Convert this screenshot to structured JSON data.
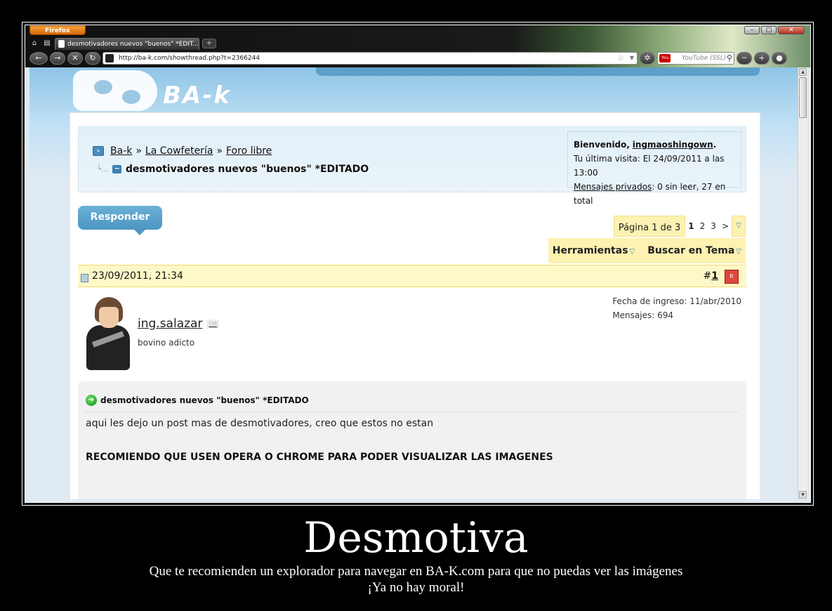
{
  "browser": {
    "menu_button": "Firefox",
    "tab_title": "desmotivadores nuevos \"buenos\" *EDIT...",
    "url": "http://ba-k.com/showthread.php?t=2366244",
    "search_placeholder": "YouTube (SSL)",
    "icons": [
      "home-icon",
      "back-icon",
      "forward-icon",
      "stop-icon",
      "reload-icon",
      "star-icon",
      "search-icon"
    ]
  },
  "site": {
    "logo_text": "BA-k"
  },
  "breadcrumb": {
    "items": [
      "Ba-k",
      "La Cowfetería",
      "Foro libre"
    ],
    "separator": "»",
    "current_thread": "desmotivadores nuevos \"buenos\" *EDITADO"
  },
  "welcome": {
    "greeting": "Bienvenido,",
    "username": "ingmaoshingown",
    "last_visit": "Tu última visita: El 24/09/2011 a las 13:00",
    "pm_link": "Mensajes privados",
    "pm_status": ": 0 sin leer, 27 en total"
  },
  "reply_button": "Responder",
  "pagination": {
    "label": "Página 1 de 3",
    "pages": [
      "1",
      "2",
      "3"
    ],
    "current": "1",
    "next": ">"
  },
  "tools": {
    "tools_label": "Herramientas",
    "search_label": "Buscar en Tema"
  },
  "post": {
    "date": "23/09/2011, 21:34",
    "number_prefix": "#",
    "number": "1",
    "username": "ing.salazar",
    "status": "Off",
    "user_title": "bovino adicto",
    "join_date": "Fecha de ingreso: 11/abr/2010",
    "messages": "Mensajes: 694",
    "title": "desmotivadores nuevos \"buenos\" *EDITADO",
    "text1": "aqui les dejo un post mas de desmotivadores, creo que estos no estan",
    "text2": "RECOMIENDO QUE USEN OPERA O CHROME PARA PODER VISUALIZAR LAS IMAGENES"
  },
  "caption": {
    "title": "Desmotiva",
    "line1": "Que te recomienden un explorador para navegar en BA-K.com para que no puedas ver las imágenes",
    "line2": "¡Ya no hay moral!"
  },
  "colors": {
    "accent_blue": "#4c96c2",
    "highlight_yellow": "#fdf2b2",
    "background": "#000000"
  }
}
